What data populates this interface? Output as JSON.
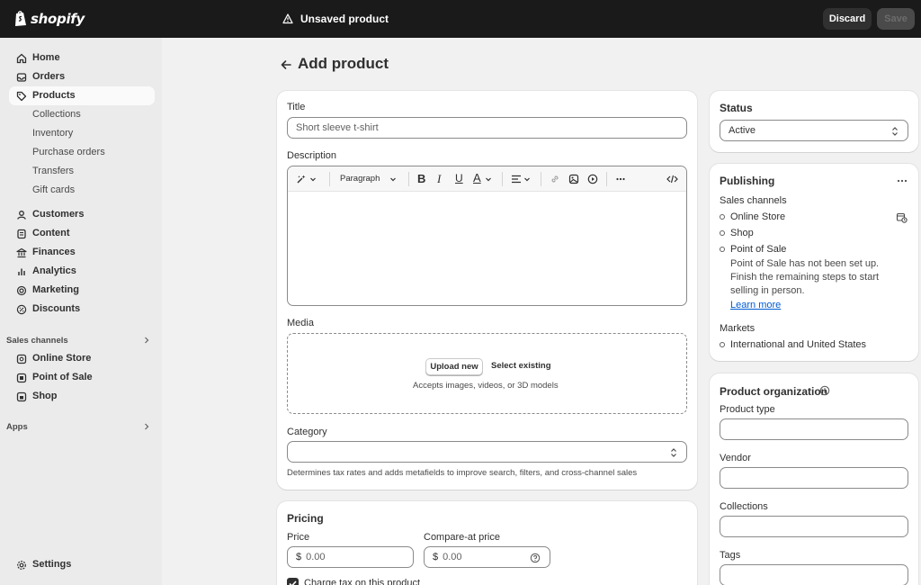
{
  "topbar": {
    "brand": "shopify",
    "status": "Unsaved product",
    "discard_label": "Discard",
    "save_label": "Save"
  },
  "sidebar": {
    "main_items": [
      {
        "label": "Home",
        "icon": "home-icon"
      },
      {
        "label": "Orders",
        "icon": "inbox-icon"
      },
      {
        "label": "Products",
        "icon": "tag-icon",
        "active": true
      }
    ],
    "product_sub": [
      "Collections",
      "Inventory",
      "Purchase orders",
      "Transfers",
      "Gift cards"
    ],
    "more_items": [
      {
        "label": "Customers",
        "icon": "person-icon"
      },
      {
        "label": "Content",
        "icon": "document-icon"
      },
      {
        "label": "Finances",
        "icon": "bank-icon"
      },
      {
        "label": "Analytics",
        "icon": "chart-icon"
      },
      {
        "label": "Marketing",
        "icon": "target-icon"
      },
      {
        "label": "Discounts",
        "icon": "discount-icon"
      }
    ],
    "sales_channels_heading": "Sales channels",
    "channels": [
      {
        "label": "Online Store",
        "icon": "store-icon"
      },
      {
        "label": "Point of Sale",
        "icon": "pos-icon"
      },
      {
        "label": "Shop",
        "icon": "shop-bag-icon"
      }
    ],
    "apps_heading": "Apps",
    "settings_label": "Settings"
  },
  "page": {
    "title": "Add product"
  },
  "product_form": {
    "title_label": "Title",
    "title_placeholder": "Short sleeve t-shirt",
    "description_label": "Description",
    "paragraph_label": "Paragraph",
    "media_label": "Media",
    "upload_new_label": "Upload new",
    "select_existing_label": "Select existing",
    "media_hint": "Accepts images, videos, or 3D models",
    "category_label": "Category",
    "category_hint": "Determines tax rates and adds metafields to improve search, filters, and cross-channel sales"
  },
  "pricing": {
    "heading": "Pricing",
    "price_label": "Price",
    "price_currency": "$",
    "price_placeholder": "0.00",
    "compare_label": "Compare-at price",
    "compare_currency": "$",
    "compare_placeholder": "0.00",
    "charge_tax_label": "Charge tax on this product"
  },
  "status_card": {
    "heading": "Status",
    "value": "Active"
  },
  "publishing": {
    "heading": "Publishing",
    "sales_channels_label": "Sales channels",
    "channels": [
      "Online Store",
      "Shop",
      "Point of Sale"
    ],
    "pos_note": "Point of Sale has not been set up. Finish the remaining steps to start selling in person.",
    "learn_more": "Learn more",
    "markets_label": "Markets",
    "markets_value": "International and United States"
  },
  "organization": {
    "heading": "Product organization",
    "product_type_label": "Product type",
    "vendor_label": "Vendor",
    "collections_label": "Collections",
    "tags_label": "Tags"
  }
}
